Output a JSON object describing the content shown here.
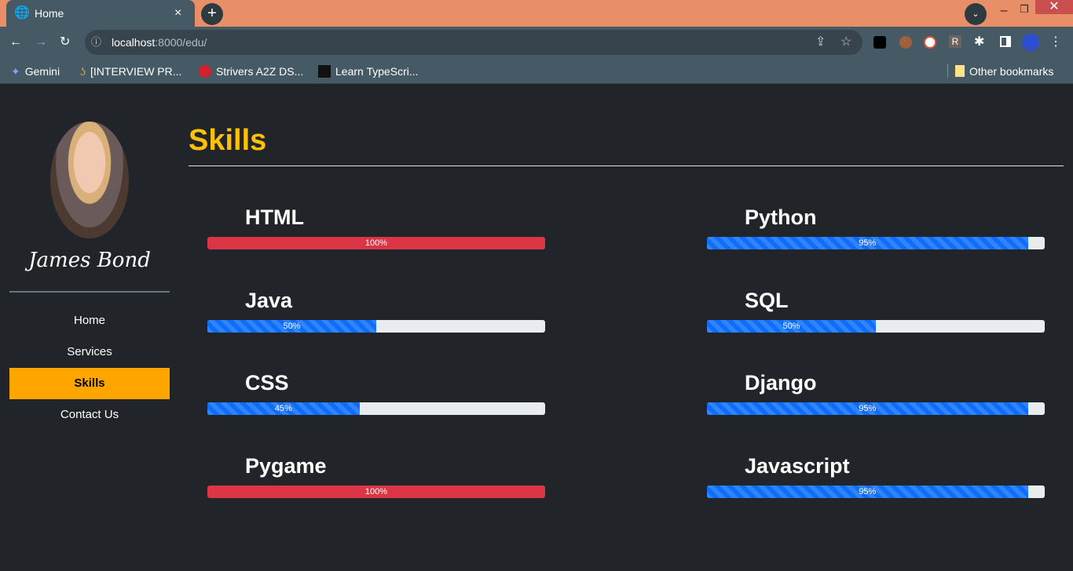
{
  "browser": {
    "tab_title": "Home",
    "url_host": "localhost",
    "url_path": ":8000/edu/",
    "bookmarks": [
      "Gemini",
      "[INTERVIEW PR...",
      "Strivers A2Z DS...",
      "Learn TypeScri..."
    ],
    "other_bookmarks": "Other bookmarks"
  },
  "sidebar": {
    "name": "James Bond",
    "nav": [
      "Home",
      "Services",
      "Skills",
      "Contact Us"
    ],
    "active": "Skills"
  },
  "main": {
    "title": "Skills",
    "skills": [
      {
        "name": "HTML",
        "percent": 100,
        "label": "100%",
        "color": "red"
      },
      {
        "name": "Python",
        "percent": 95,
        "label": "95%",
        "color": "blue"
      },
      {
        "name": "Java",
        "percent": 50,
        "label": "50%",
        "color": "blue"
      },
      {
        "name": "SQL",
        "percent": 50,
        "label": "50%",
        "color": "blue"
      },
      {
        "name": "CSS",
        "percent": 45,
        "label": "45%",
        "color": "blue"
      },
      {
        "name": "Django",
        "percent": 95,
        "label": "95%",
        "color": "blue"
      },
      {
        "name": "Pygame",
        "percent": 100,
        "label": "100%",
        "color": "red"
      },
      {
        "name": "Javascript",
        "percent": 95,
        "label": "95%",
        "color": "blue"
      }
    ]
  }
}
